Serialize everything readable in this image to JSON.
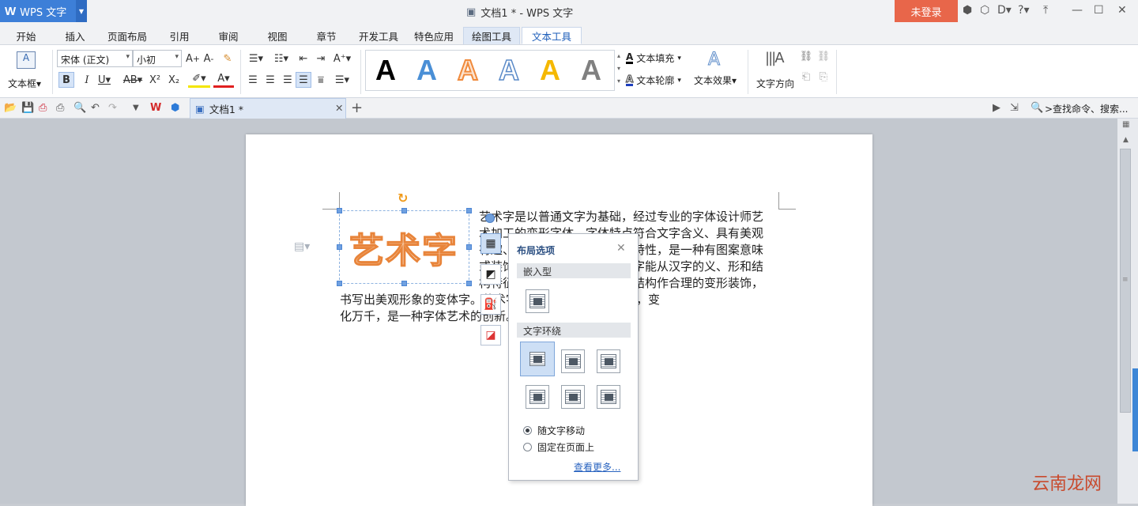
{
  "titlebar": {
    "app_label": "WPS 文字",
    "window_title": "文档1 * - WPS 文字",
    "login": "未登录",
    "help": "?"
  },
  "tabs": {
    "items": [
      "开始",
      "插入",
      "页面布局",
      "引用",
      "审阅",
      "视图",
      "章节",
      "开发工具",
      "特色应用",
      "绘图工具",
      "文本工具"
    ],
    "active": "文本工具"
  },
  "ribbon": {
    "textbox_label": "文本框",
    "font_name": "宋体 (正文)",
    "font_size": "小初",
    "wordart_letter": "A",
    "wordart_colors": [
      "#000000",
      "#4a8fd6",
      "#f08a3c",
      "#ffffff",
      "#f5b800",
      "#808080"
    ],
    "text_fill": "文本填充",
    "text_outline": "文本轮廓",
    "text_effect": "文本效果",
    "text_direction": "文字方向"
  },
  "quickbar": {
    "doc_tab": "文档1 *",
    "search": ">查找命令、搜索..."
  },
  "document": {
    "wordart": "艺术字",
    "lines": [
      "艺术字是以普通文字为基础，经过专业的字体设计师艺",
      "术加工的变形字体，字体特点符合文字含义、具有美观",
      "有趣、易认易识、醒目张扬等特性，是一种有图案意味",
      "或装饰意味的字体变形。艺术字能从汉字的义、形和结",
      "构特征出发，对汉字的笔画和结构作合理的变形装饰，",
      "书写出美观形象的变体字。艺术字经过变体后，千姿百态，变",
      "化万千，是一种字体艺术的创新。"
    ]
  },
  "popup": {
    "title": "布局选项",
    "inline_section": "嵌入型",
    "wrap_section": "文字环绕",
    "move_with_text": "随文字移动",
    "fix_on_page": "固定在页面上",
    "more_link": "查看更多..."
  },
  "watermark": "云南龙网"
}
